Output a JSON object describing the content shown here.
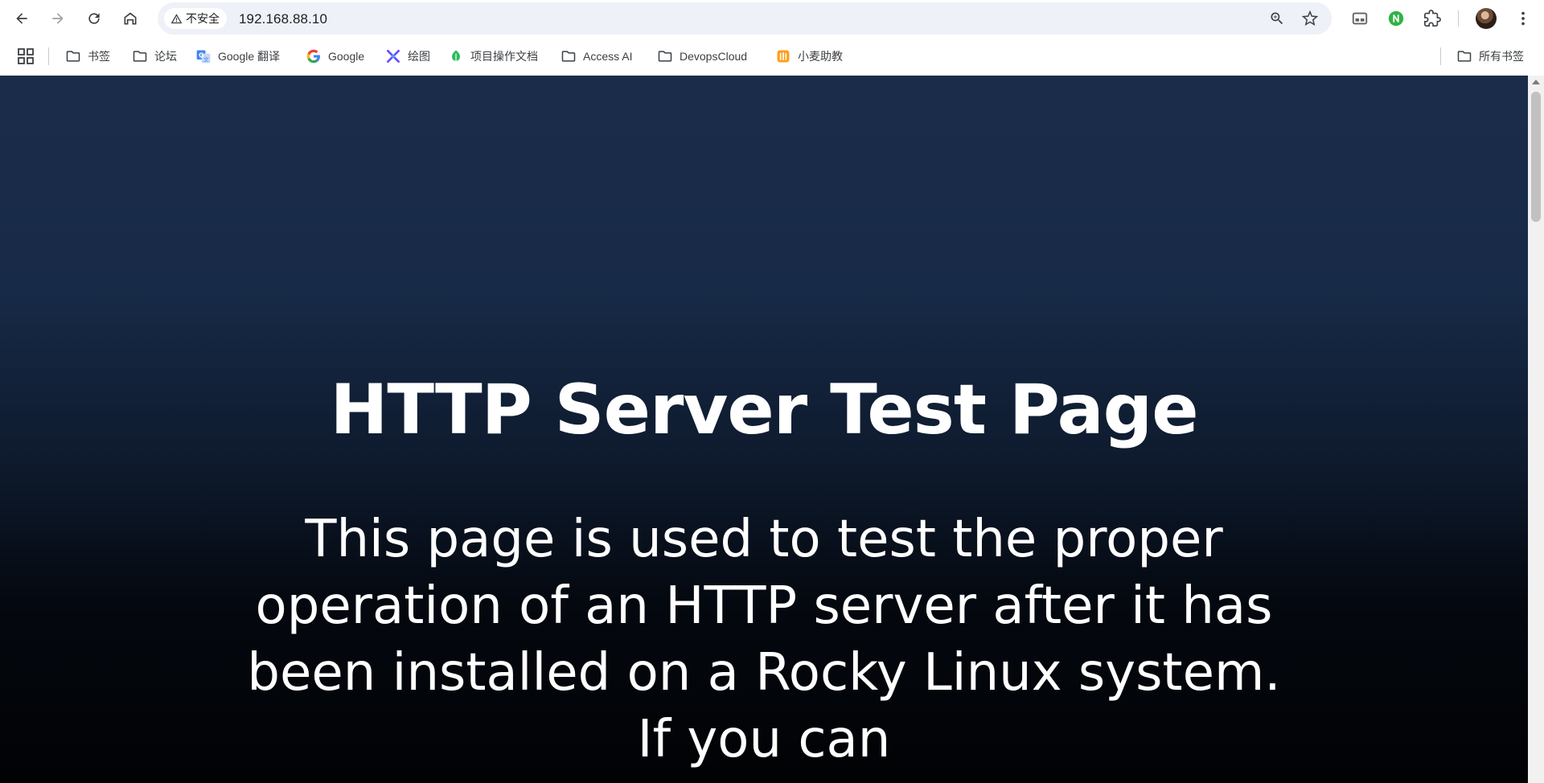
{
  "browser": {
    "security_label": "不安全",
    "url": "192.168.88.10",
    "icons": {
      "back": "arrow-left-icon",
      "forward": "arrow-right-icon",
      "reload": "reload-icon",
      "home": "home-icon",
      "zoom": "zoom-icon",
      "bookmark_star": "star-icon",
      "tab_search": "tab-search-icon",
      "extension_n": "extension-n-icon",
      "extensions": "puzzle-icon",
      "menu": "kebab-menu-icon"
    }
  },
  "bookmarks": {
    "items": [
      {
        "label": "书签",
        "icon": "folder-icon"
      },
      {
        "label": "论坛",
        "icon": "folder-icon"
      },
      {
        "label": "Google 翻译",
        "icon": "google-translate-icon"
      },
      {
        "label": "Google",
        "icon": "google-icon"
      },
      {
        "label": "绘图",
        "icon": "drawing-icon"
      },
      {
        "label": "项目操作文档",
        "icon": "doc-leaf-icon"
      },
      {
        "label": "Access AI",
        "icon": "folder-icon"
      },
      {
        "label": "DevopsCloud",
        "icon": "folder-icon"
      },
      {
        "label": "小麦助教",
        "icon": "xiaomai-icon"
      }
    ],
    "all_bookmarks": "所有书签"
  },
  "page": {
    "title": "HTTP Server Test Page",
    "description": "This page is used to test the proper operation of an HTTP server after it has been installed on a Rocky Linux system. If you can"
  },
  "colors": {
    "background_top": "#1b2c4a",
    "background_bottom": "#010204",
    "text": "#ffffff"
  }
}
